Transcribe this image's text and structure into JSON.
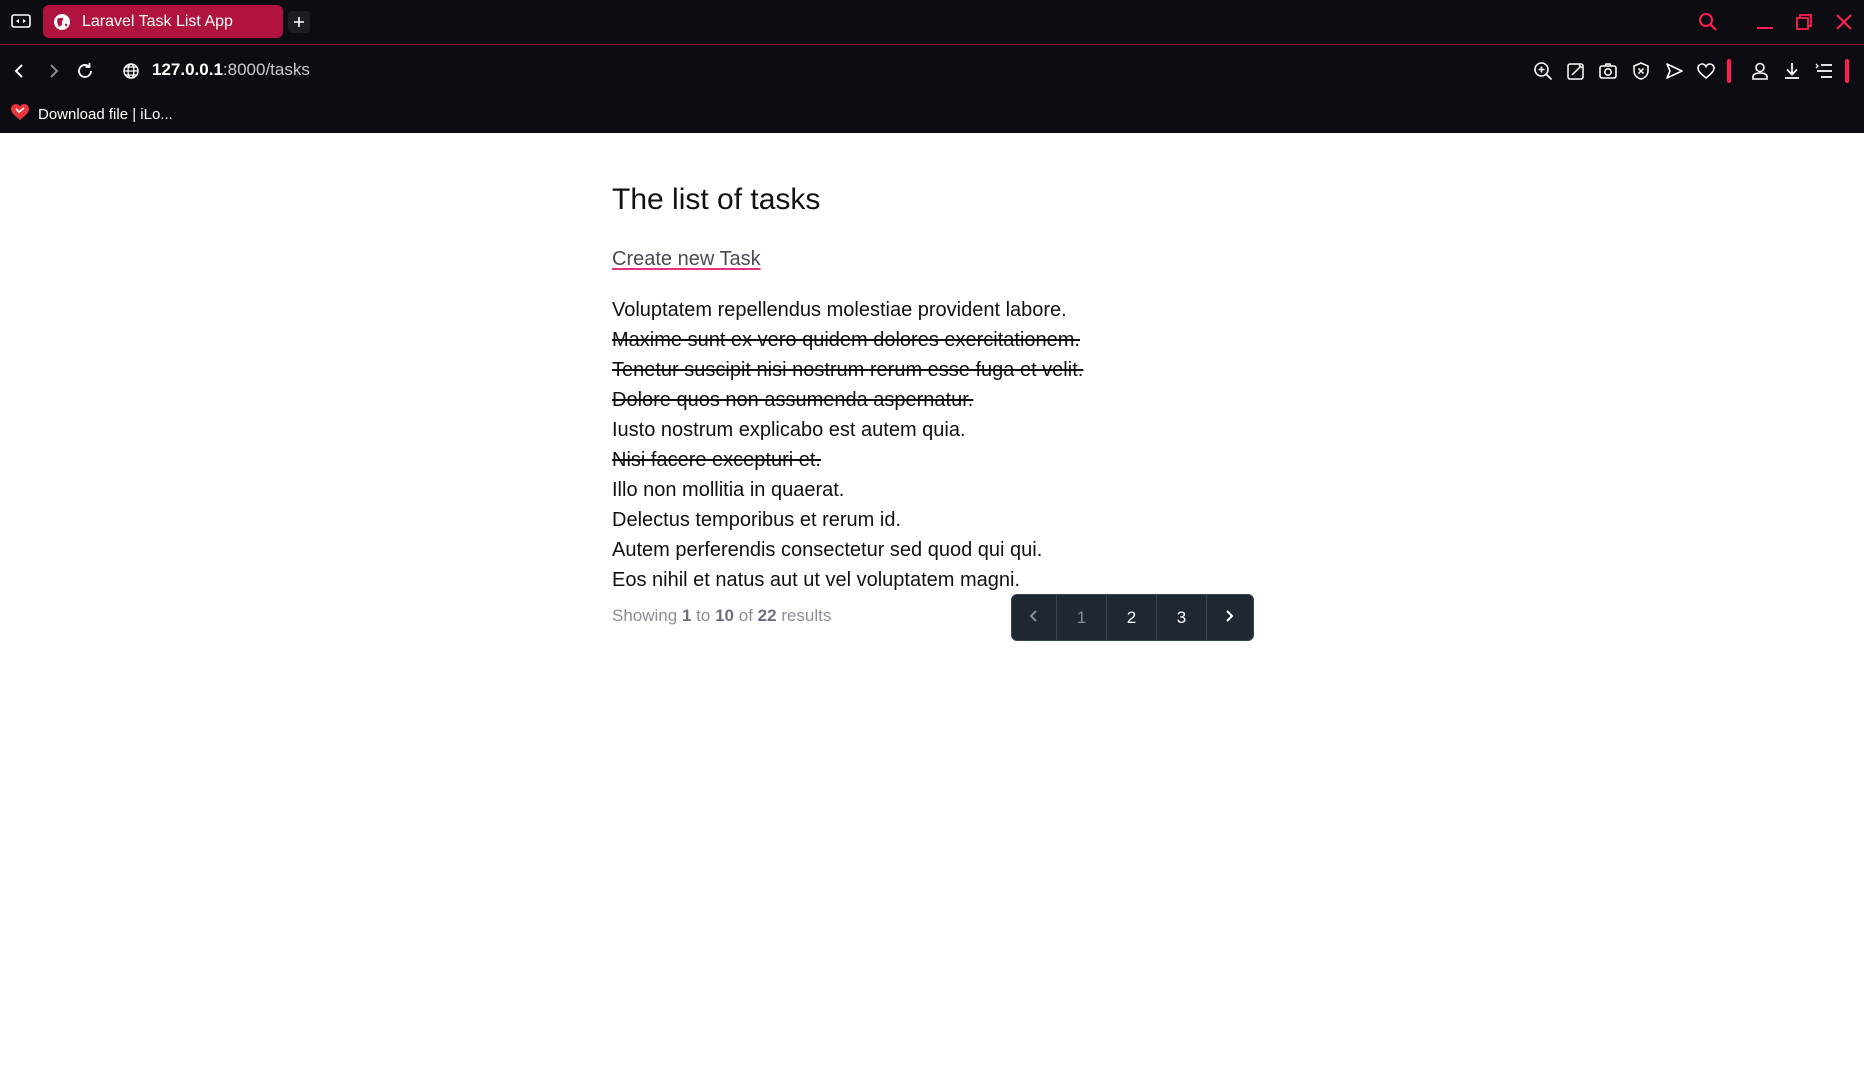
{
  "browser": {
    "tab_title": "Laravel Task List App",
    "url_host": "127.0.0.1",
    "url_path": ":8000/tasks",
    "bookmark_label": "Download file | iLo...",
    "accent_color": "#ff1f4f",
    "tab_color": "#b0133d"
  },
  "page": {
    "title": "The list of tasks",
    "create_link": "Create new Task",
    "tasks": [
      {
        "text": "Voluptatem repellendus molestiae provident labore.",
        "completed": false
      },
      {
        "text": "Maxime sunt ex vero quidem dolores exercitationem.",
        "completed": true
      },
      {
        "text": "Tenetur suscipit nisi nostrum rerum esse fuga et velit.",
        "completed": true
      },
      {
        "text": "Dolore quos non assumenda aspernatur.",
        "completed": true
      },
      {
        "text": "Iusto nostrum explicabo est autem quia.",
        "completed": false
      },
      {
        "text": "Nisi facere excepturi et.",
        "completed": true
      },
      {
        "text": "Illo non mollitia in quaerat.",
        "completed": false
      },
      {
        "text": "Delectus temporibus et rerum id.",
        "completed": false
      },
      {
        "text": "Autem perferendis consectetur sed quod qui qui.",
        "completed": false
      },
      {
        "text": "Eos nihil et natus aut ut vel voluptatem magni.",
        "completed": false
      }
    ],
    "pagination": {
      "showing_prefix": "Showing",
      "from": "1",
      "to_word": "to",
      "to": "10",
      "of_word": "of",
      "total": "22",
      "suffix": "results",
      "pages": [
        "1",
        "2",
        "3"
      ],
      "current_page": "1"
    }
  }
}
